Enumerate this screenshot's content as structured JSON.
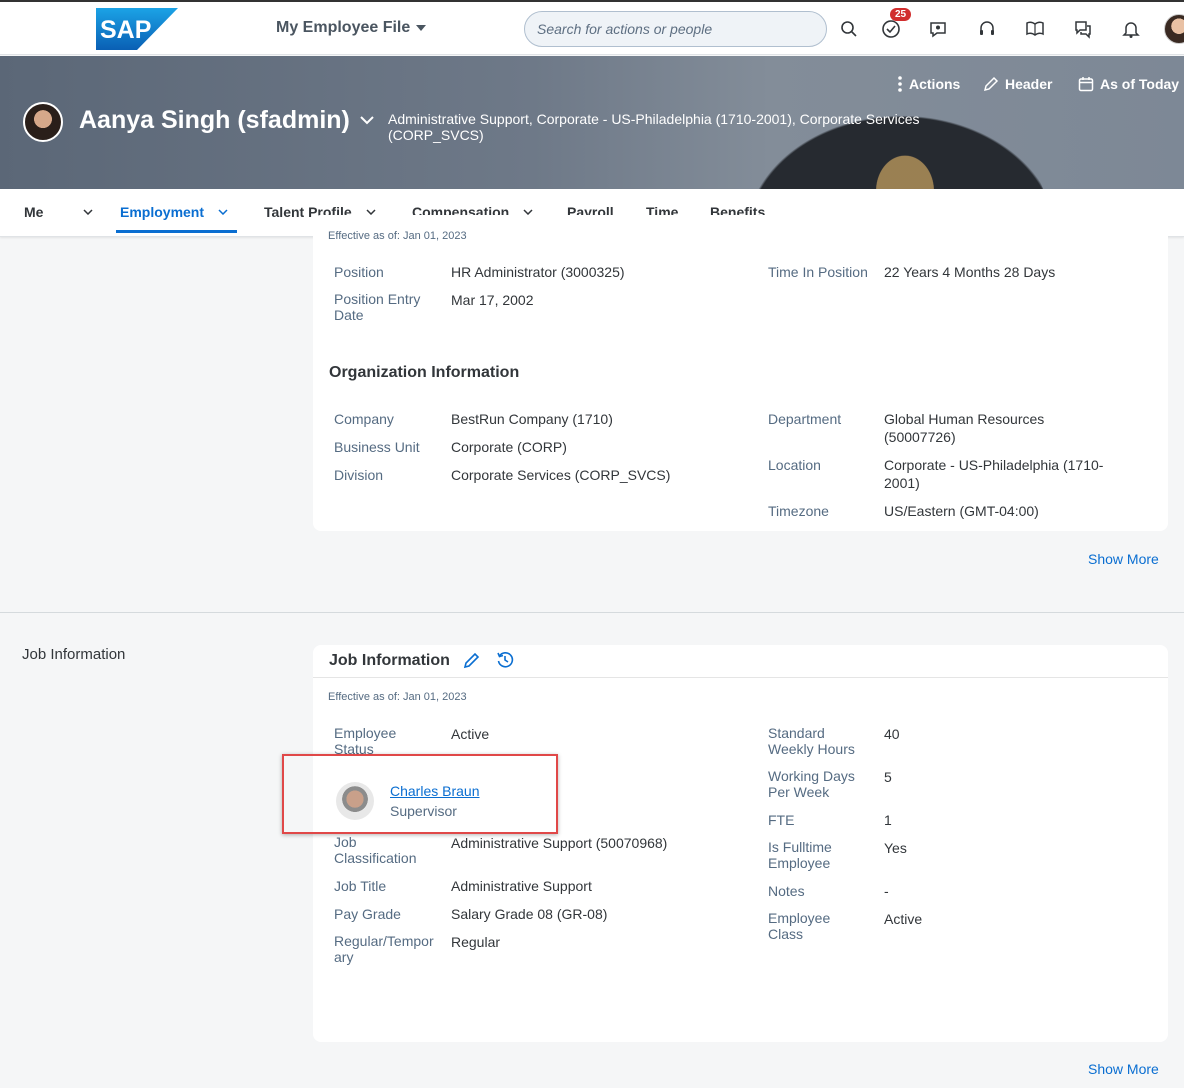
{
  "shell": {
    "logo_text": "SAP",
    "app_title": "My Employee File",
    "search_placeholder": "Search for actions or people",
    "notification_count": "25"
  },
  "header": {
    "actions_label": "Actions",
    "header_label": "Header",
    "as_of_label": "As of Today",
    "employee_name": "Aanya Singh (sfadmin)",
    "employee_subtitle": "Administrative Support, Corporate - US-Philadelphia (1710-2001), Corporate Services (CORP_SVCS)"
  },
  "tabs": {
    "me": "Me",
    "employment": "Employment",
    "talent_profile": "Talent Profile",
    "compensation": "Compensation",
    "payroll": "Payroll",
    "time": "Time",
    "benefits": "Benefits"
  },
  "position_card": {
    "effective": "Effective as of: Jan 01, 2023",
    "position_label": "Position",
    "position_value": "HR Administrator (3000325)",
    "entry_label": "Position Entry Date",
    "entry_value": "Mar 17, 2002",
    "time_label": "Time In Position",
    "time_value": "22 Years 4 Months 28 Days",
    "org_title": "Organization Information",
    "company_label": "Company",
    "company_value": "BestRun Company (1710)",
    "bu_label": "Business Unit",
    "bu_value": "Corporate (CORP)",
    "division_label": "Division",
    "division_value": "Corporate Services (CORP_SVCS)",
    "department_label": "Department",
    "department_value": "Global Human Resources (50007726)",
    "location_label": "Location",
    "location_value": "Corporate - US-Philadelphia (1710-2001)",
    "timezone_label": "Timezone",
    "timezone_value": "US/Eastern (GMT-04:00)",
    "show_more": "Show More"
  },
  "job_section": {
    "side_label": "Job Information",
    "title": "Job Information",
    "effective": "Effective as of: Jan 01, 2023",
    "emp_status_label": "Employee Status",
    "emp_status_value": "Active",
    "supervisor_name": "Charles Braun",
    "supervisor_role": "Supervisor",
    "job_class_label": "Job Classification",
    "job_class_value": "Administrative Support (50070968)",
    "job_title_label": "Job Title",
    "job_title_value": "Administrative Support",
    "pay_grade_label": "Pay Grade",
    "pay_grade_value": "Salary Grade 08 (GR-08)",
    "regular_label": "Regular/Temporary",
    "regular_value": "Regular",
    "std_hours_label": "Standard Weekly Hours",
    "std_hours_value": "40",
    "working_days_label": "Working Days Per Week",
    "working_days_value": "5",
    "fte_label": "FTE",
    "fte_value": "1",
    "fulltime_label": "Is Fulltime Employee",
    "fulltime_value": "Yes",
    "notes_label": "Notes",
    "notes_value": "-",
    "emp_class_label": "Employee Class",
    "emp_class_value": "Active",
    "show_more": "Show More"
  },
  "colors": {
    "accent": "#0a6ed1",
    "badge": "#d12d2d",
    "highlight": "#e04848"
  }
}
